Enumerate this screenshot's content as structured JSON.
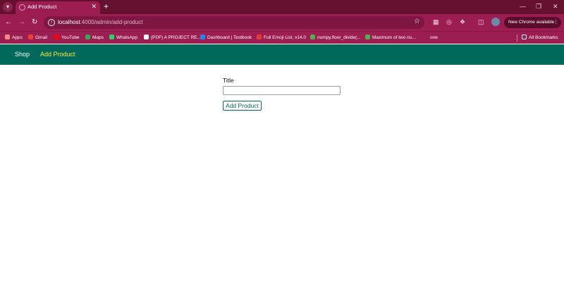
{
  "browser": {
    "tab": {
      "title": "Add Product"
    },
    "address": {
      "host": "localhost",
      "path": ":4000/admin/add-product"
    },
    "update_button": "New Chrome available",
    "bookmarks": [
      {
        "label": "Apps",
        "color": "#f28b82"
      },
      {
        "label": "Gmail",
        "color": "#ea4335"
      },
      {
        "label": "YouTube",
        "color": "#ff0000"
      },
      {
        "label": "Maps",
        "color": "#34a853"
      },
      {
        "label": "WhatsApp",
        "color": "#25d366"
      },
      {
        "label": "(PDF) A PROJECT RE...",
        "color": "#ffffff"
      },
      {
        "label": "Dashboard | Testbook",
        "color": "#1e88e5"
      },
      {
        "label": "Full Emoji List, v14.0",
        "color": "#e53935"
      },
      {
        "label": "numpy.floor_divide(...",
        "color": "#4caf50"
      },
      {
        "label": "Maximum of two nu...",
        "color": "#4caf50"
      },
      {
        "label": "one",
        "color": "#9c1d52"
      }
    ],
    "all_bookmarks": "All Bookmarks"
  },
  "nav": {
    "shop": "Shop",
    "add_product": "Add Product",
    "active_color": "#ffeb3b",
    "header_color": "#00695c"
  },
  "form": {
    "title_label": "Title",
    "title_value": "",
    "submit_label": "Add Product"
  }
}
